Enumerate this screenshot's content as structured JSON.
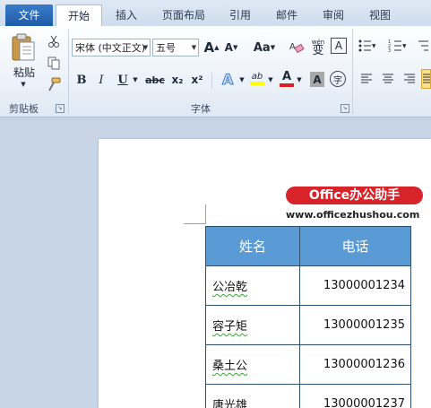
{
  "tabs": {
    "file": "文件",
    "items": [
      "开始",
      "插入",
      "页面布局",
      "引用",
      "邮件",
      "审阅",
      "视图"
    ],
    "active": 0
  },
  "clipboard": {
    "paste_label": "粘贴",
    "group_label": "剪贴板"
  },
  "font_group": {
    "font_name": "宋体 (中文正文)",
    "font_size": "五号",
    "group_label": "字体",
    "grow_label": "A",
    "shrink_label": "A",
    "case_label": "Aa",
    "bold": "B",
    "italic": "I",
    "underline": "U",
    "strike": "abc",
    "subscript": "x₂",
    "superscript": "x²",
    "phonetic_label": "wén",
    "phonetic_char": "变",
    "border_char": "A",
    "highlight_label": "ab",
    "font_color_label": "A",
    "shading_char": "A",
    "enclose_char": "字"
  },
  "colors": {
    "header_fill": "#5b9bd5",
    "logo_red": "#d8232a",
    "file_tab": "#2b6cb8",
    "highlight_yellow": "#ffff00",
    "font_red": "#e02020"
  },
  "watermark": {
    "brand": "Office办公助手",
    "url": "www.officezhushou.com"
  },
  "table": {
    "headers": [
      "姓名",
      "电话"
    ],
    "rows": [
      {
        "name": "公冶乾",
        "phone": "13000001234"
      },
      {
        "name": "容子矩",
        "phone": "13000001235"
      },
      {
        "name": "桑土公",
        "phone": "13000001236"
      },
      {
        "name": "唐光雄",
        "phone": "13000001237"
      }
    ]
  }
}
